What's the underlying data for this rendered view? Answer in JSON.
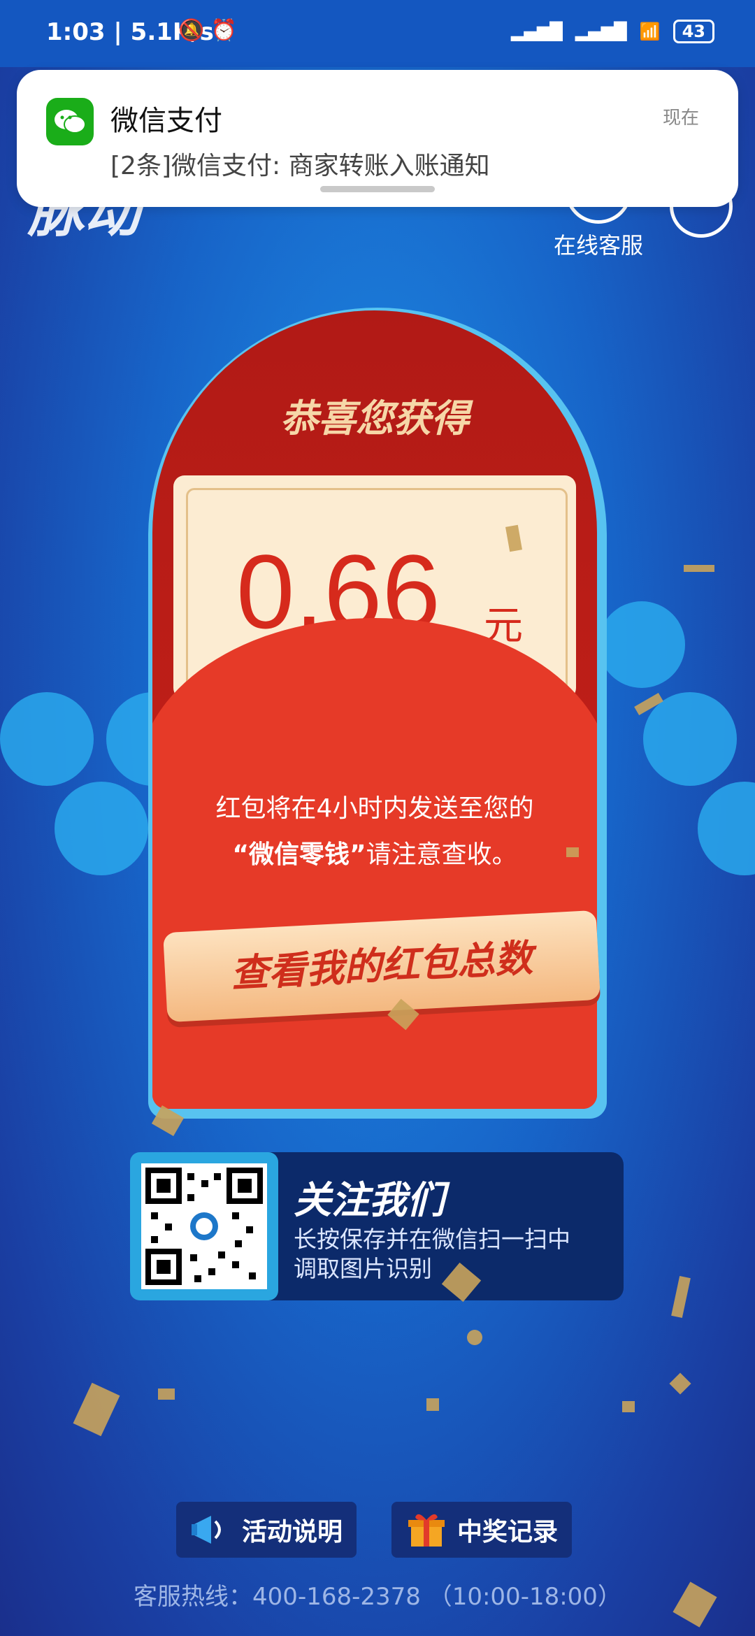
{
  "status_bar": {
    "time_speed": "1:03 | 5.1K/s",
    "battery": "43"
  },
  "notification": {
    "app_name": "微信支付",
    "time": "现在",
    "body": "[2条]微信支付: 商家转账入账通知"
  },
  "header": {
    "logo": "脉动",
    "service_label": "在线客服"
  },
  "red_packet": {
    "title": "恭喜您获得",
    "amount": "0.66",
    "unit": "元",
    "line1": "红包将在4小时内发送至您的",
    "line2_highlight": "“微信零钱”",
    "line2_rest": "请注意查收。",
    "cta": "查看我的红包总数"
  },
  "follow": {
    "title": "关注我们",
    "desc1": "长按保存并在微信扫一扫中",
    "desc2": "调取图片识别"
  },
  "bottom": {
    "rules": "活动说明",
    "records": "中奖记录",
    "hotline": "客服热线：400-168-2378 （10:00-18:00）"
  },
  "colors": {
    "red": "#d62a1c",
    "blue": "#1764c8",
    "wechat_green": "#1aad19"
  }
}
